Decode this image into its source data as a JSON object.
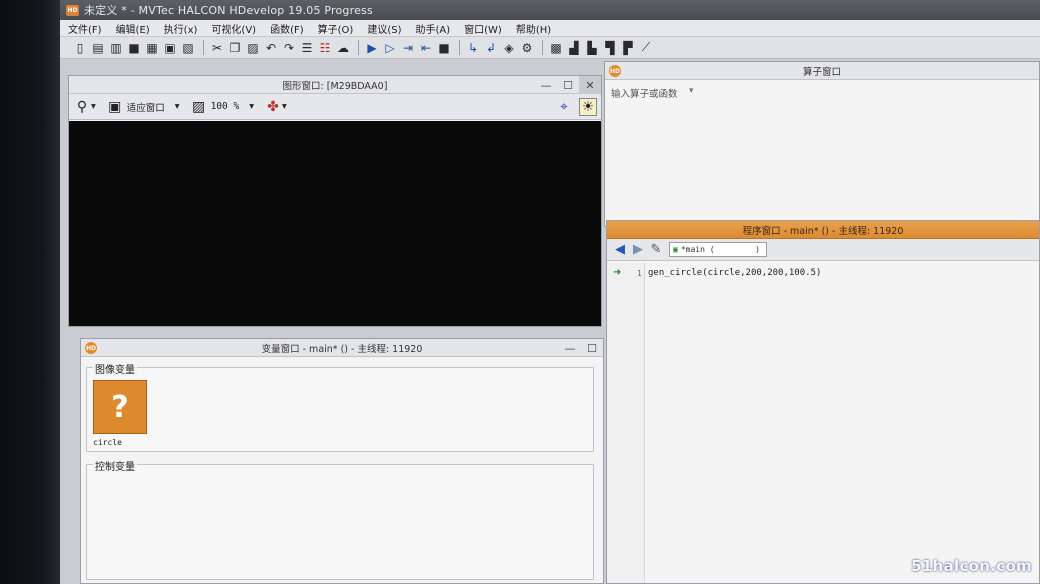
{
  "window": {
    "title": "未定义 * - MVTec HALCON HDevelop 19.05 Progress",
    "logo": "HD"
  },
  "menu": [
    "文件(F)",
    "编辑(E)",
    "执行(x)",
    "可视化(V)",
    "函数(F)",
    "算子(O)",
    "建议(S)",
    "助手(A)",
    "窗口(W)",
    "帮助(H)"
  ],
  "toolbar_icons": [
    "new-file",
    "open-file",
    "open-example",
    "save",
    "save-all",
    "print",
    "page-setup",
    "cut",
    "copy",
    "paste",
    "undo",
    "redo",
    "insert",
    "delete",
    "run",
    "step",
    "step-into",
    "step-out",
    "stop",
    "reset",
    "activate",
    "deactivate",
    "breakpoint",
    "zoom",
    "histogram",
    "profile",
    "inspect",
    "feature",
    "measure"
  ],
  "graphics_window": {
    "title": "图形窗口: [M29BDAA0]",
    "fit_label": "适应窗口",
    "zoom_value": "100 %"
  },
  "operator_window": {
    "title": "算子窗口",
    "input_placeholder": "输入算子或函数"
  },
  "program_window": {
    "title": "程序窗口 - main* () - 主线程: 11920",
    "procedure": "*main (",
    "procedure_close": ")",
    "line_number": "1",
    "code_line": "gen_circle(circle,200,200,100.5)"
  },
  "variable_window": {
    "title": "变量窗口 - main* () - 主线程: 11920",
    "iconic_label": "图像变量",
    "control_label": "控制变量",
    "iconic_var_name": "circle",
    "placeholder_glyph": "?"
  },
  "watermark": "51halcon.com",
  "colors": {
    "accent_orange": "#dd8a2e",
    "canvas_black": "#0a0a0b"
  }
}
